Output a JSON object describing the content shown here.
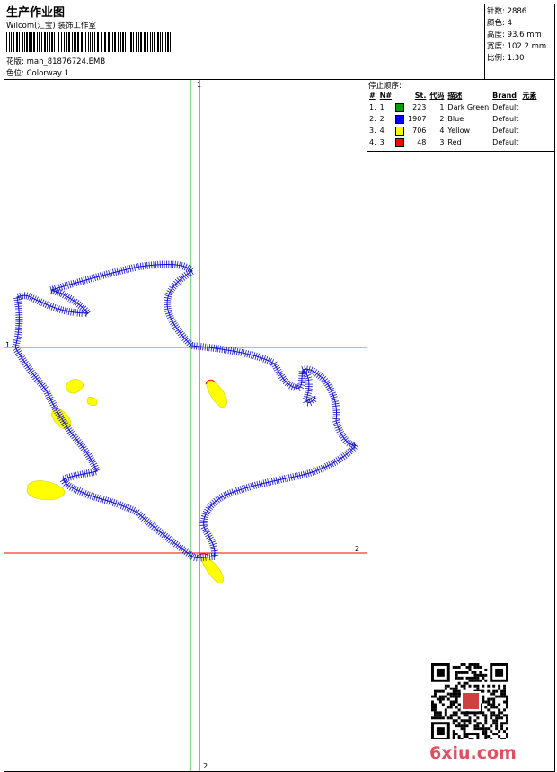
{
  "header": {
    "title": "生产作业图",
    "studio": "Wilcom(汇宝) 装饰工作室",
    "file_label": "花版:",
    "file_name": "man_81876724.EMB",
    "colorway_label": "色位:",
    "colorway": "Colorway 1"
  },
  "specs": [
    {
      "label": "针数:",
      "value": "2886"
    },
    {
      "label": "颜色:",
      "value": "4"
    },
    {
      "label": "高度:",
      "value": "93.6 mm"
    },
    {
      "label": "宽度:",
      "value": "102.2 mm"
    },
    {
      "label": "比例:",
      "value": "1.30"
    }
  ],
  "stop_sequence": {
    "title": "停止顺序:",
    "columns": [
      "#",
      "N#",
      "St.",
      "代码",
      "描述",
      "Brand",
      "元素"
    ],
    "rows": [
      {
        "seq": "1.",
        "n": "1",
        "color": "#00a000",
        "stitches": "223",
        "code": "1",
        "desc": "Dark Green",
        "brand": "Default"
      },
      {
        "seq": "2.",
        "n": "2",
        "color": "#0000ff",
        "stitches": "1907",
        "code": "2",
        "desc": "Blue",
        "brand": "Default"
      },
      {
        "seq": "3.",
        "n": "4",
        "color": "#ffff00",
        "stitches": "706",
        "code": "4",
        "desc": "Yellow",
        "brand": "Default"
      },
      {
        "seq": "4.",
        "n": "3",
        "color": "#ff0000",
        "stitches": "48",
        "code": "3",
        "desc": "Red",
        "brand": "Default"
      }
    ]
  },
  "guides": {
    "label_1_top": "1",
    "label_1_left": "1",
    "label_2_right": "2",
    "label_2_bottom": "2"
  },
  "watermark": "6xiu.com",
  "colors": {
    "green": "#00c000",
    "red": "#ff0000",
    "blue": "#1010d0",
    "yellow": "#ffff00"
  }
}
